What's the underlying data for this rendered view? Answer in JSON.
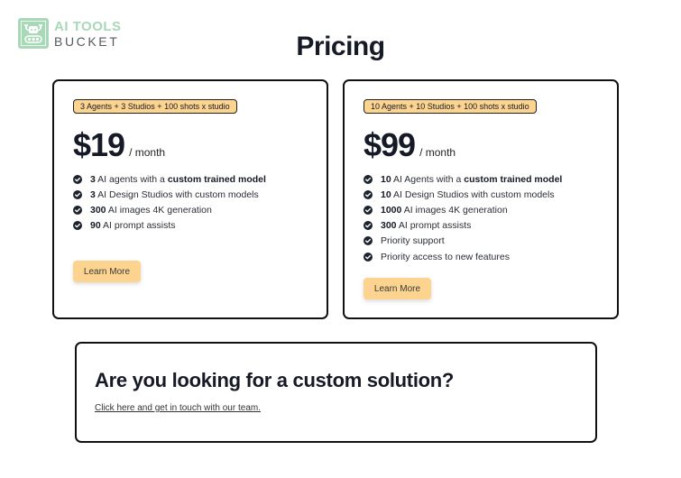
{
  "logo": {
    "line1": "AI TOOLS",
    "line2": "BUCKET",
    "icon": "robot-icon",
    "color": "#a8d8b7"
  },
  "page_title": "Pricing",
  "plans": [
    {
      "badge": "3 Agents + 3 Studios + 100 shots x studio",
      "price": "$19",
      "period": "/ month",
      "features": [
        {
          "bold": "3",
          "text": " AI agents with a ",
          "bold2": "custom trained model"
        },
        {
          "bold": "3",
          "text": " AI Design Studios with custom models",
          "bold2": ""
        },
        {
          "bold": "300",
          "text": " AI images 4K generation",
          "bold2": ""
        },
        {
          "bold": "90",
          "text": " AI prompt assists",
          "bold2": ""
        }
      ],
      "button": "Learn More"
    },
    {
      "badge": "10 Agents + 10 Studios + 100 shots x studio",
      "price": "$99",
      "period": "/ month",
      "features": [
        {
          "bold": "10",
          "text": " AI Agents with a ",
          "bold2": "custom trained model"
        },
        {
          "bold": "10",
          "text": " AI Design Studios with custom models",
          "bold2": ""
        },
        {
          "bold": "1000",
          "text": " AI images 4K generation",
          "bold2": ""
        },
        {
          "bold": "300",
          "text": " AI prompt assists",
          "bold2": ""
        },
        {
          "bold": "",
          "text": "Priority support",
          "bold2": ""
        },
        {
          "bold": "",
          "text": "Priority access to new features",
          "bold2": ""
        }
      ],
      "button": "Learn More"
    }
  ],
  "custom": {
    "title": "Are you looking for a custom solution?",
    "link": "Click here and get in touch with our team."
  },
  "colors": {
    "accent": "#fcd48f",
    "text": "#161a26",
    "border": "#111111"
  }
}
